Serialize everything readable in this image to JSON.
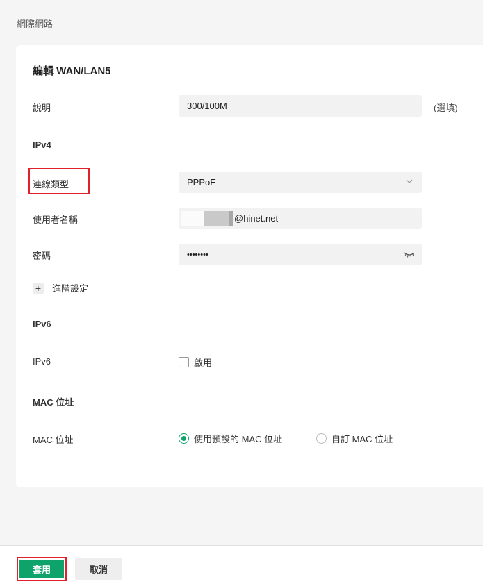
{
  "breadcrumb": "網際網路",
  "card": {
    "title": "編輯 WAN/LAN5"
  },
  "form": {
    "description": {
      "label": "說明",
      "value": "300/100M",
      "optional": "(選填)"
    },
    "ipv4_section": "IPv4",
    "connection_type": {
      "label": "連線類型",
      "value": "PPPoE"
    },
    "username": {
      "label": "使用者名稱",
      "suffix": "@hinet.net"
    },
    "password": {
      "label": "密碼",
      "value": "••••••••"
    },
    "advanced": {
      "plus": "+",
      "label": "進階設定"
    },
    "ipv6_section": "IPv6",
    "ipv6": {
      "label": "IPv6",
      "checkbox_label": "啟用",
      "enabled": false
    },
    "mac_section": "MAC 位址",
    "mac": {
      "label": "MAC 位址",
      "option_default": "使用預設的 MAC 位址",
      "option_custom": "自訂 MAC 位址",
      "selected": "default"
    }
  },
  "footer": {
    "apply_label": "套用",
    "cancel_label": "取消"
  },
  "colors": {
    "accent": "#0ea36a",
    "highlight": "#e0202a"
  }
}
